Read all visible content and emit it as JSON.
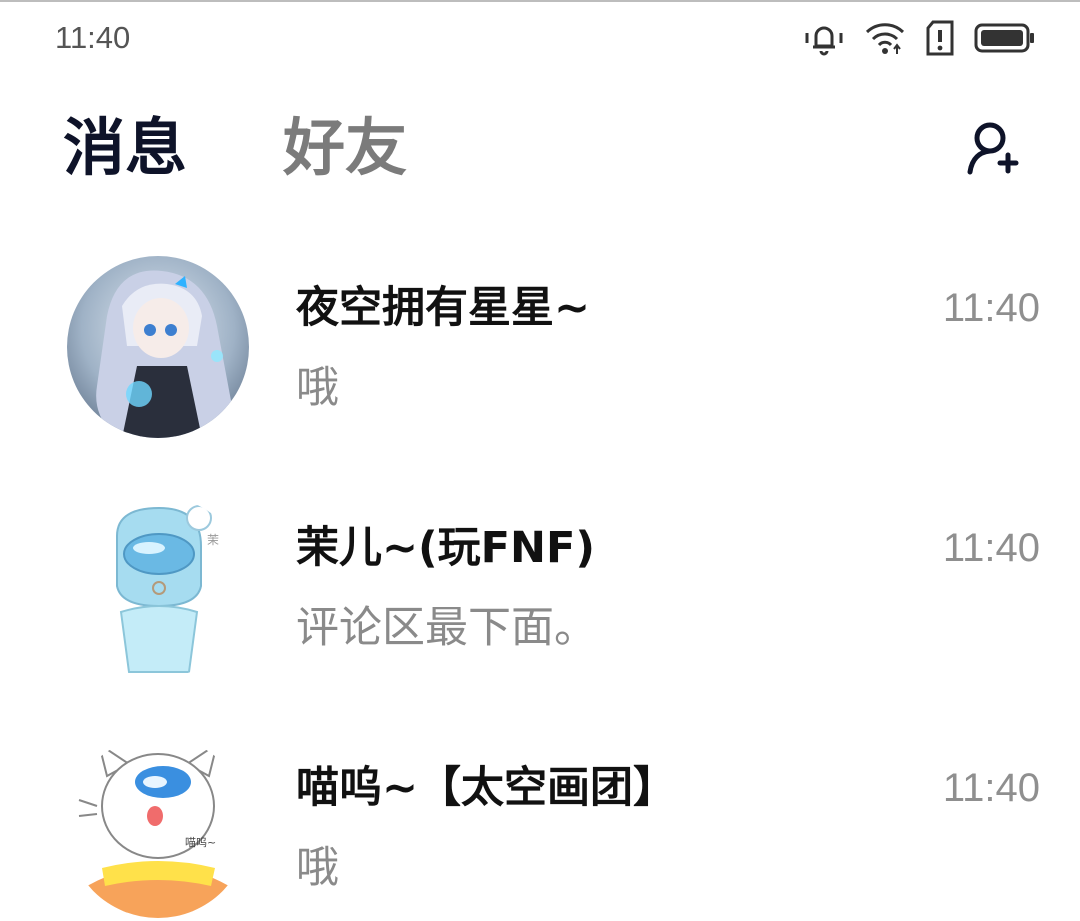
{
  "status_bar": {
    "time": "11:40",
    "icons": [
      "bell-vibrate-icon",
      "wifi-icon",
      "sim-alert-icon",
      "battery-icon"
    ]
  },
  "header": {
    "tabs": [
      {
        "label": "消息",
        "active": true
      },
      {
        "label": "好友",
        "active": false
      }
    ],
    "add_friend_icon": "add-user-icon"
  },
  "conversations": [
    {
      "name": "夜空拥有星星~",
      "preview": "哦",
      "time": "11:40",
      "avatar": "anime-girl-avatar"
    },
    {
      "name": "茉儿~(玩FNF)",
      "preview": "评论区最下面。",
      "time": "11:40",
      "avatar": "blue-crewmate-avatar"
    },
    {
      "name": "喵呜~【太空画团】",
      "preview": "哦",
      "time": "11:40",
      "avatar": "white-cat-avatar"
    }
  ],
  "colors": {
    "active_tab": "#0e1329",
    "inactive_tab": "#7b7b7b",
    "preview_text": "#8a8a8a",
    "time_text": "#8f8f8f"
  }
}
